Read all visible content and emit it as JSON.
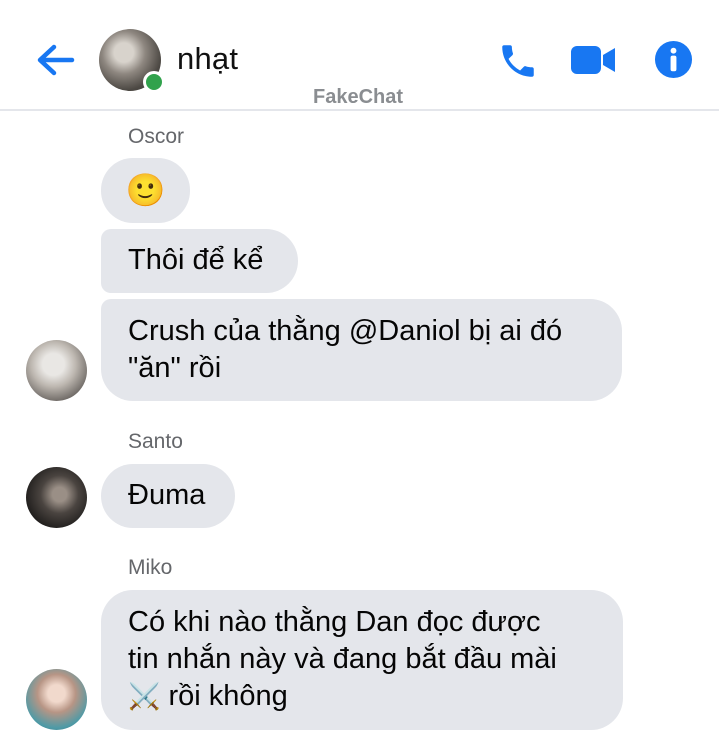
{
  "header": {
    "contact_name": "nhạt",
    "watermark": "FakeChat",
    "back_icon": "arrow-left-icon",
    "call_icon": "phone-icon",
    "video_icon": "video-camera-icon",
    "info_icon": "info-icon",
    "accent_color": "#1877f2"
  },
  "messages": {
    "group1": {
      "sender": "Oscor",
      "m1": "🙂",
      "m2": "Thôi để kể",
      "m3_line1": "Crush của thằng @Daniol bị ai đó",
      "m3_line2": "\"ăn\" rồi"
    },
    "group2": {
      "sender": "Santo",
      "m1": "Đuma"
    },
    "group3": {
      "sender": "Miko",
      "m1_line1": "Có khi nào thằng Dan đọc được",
      "m1_line2": "tin nhắn này và đang bắt đầu mài",
      "m1_line3_emoji": "⚔️",
      "m1_line3": "rồi không"
    }
  },
  "colors": {
    "bubble_bg": "#e4e6eb",
    "online_dot": "#31a24c"
  }
}
